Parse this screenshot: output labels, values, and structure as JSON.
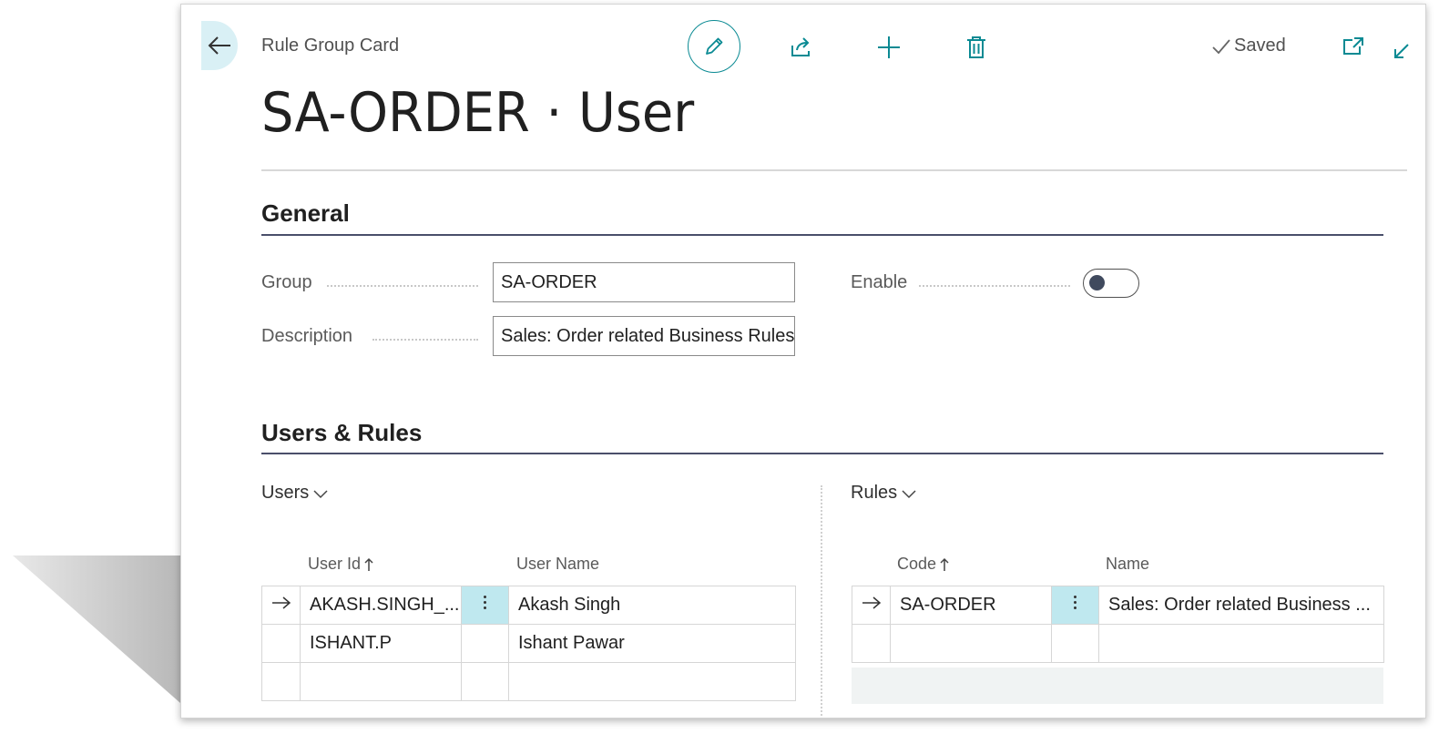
{
  "header": {
    "caption": "Rule Group Card",
    "saved_label": "Saved",
    "title": "SA-ORDER · User"
  },
  "icons": {
    "back": "back-arrow-icon",
    "edit": "pencil-icon",
    "share": "share-icon",
    "new": "plus-icon",
    "delete": "trash-icon",
    "open_new": "open-in-new-window-icon",
    "collapse": "collapse-icon",
    "check": "check-icon"
  },
  "colors": {
    "accent": "#0a8a93",
    "selected_cell": "#bfe8ef",
    "back_button": "#d9f0f5",
    "section_line": "#4a4f6a"
  },
  "general": {
    "heading": "General",
    "group_label": "Group",
    "group_value": "SA-ORDER",
    "description_label": "Description",
    "description_value": "Sales: Order related Business Rules",
    "enable_label": "Enable",
    "enable_value": false
  },
  "users_rules": {
    "heading": "Users & Rules",
    "users": {
      "title": "Users",
      "columns": [
        "User Id",
        "User Name"
      ],
      "rows": [
        {
          "user_id": "AKASH.SINGH_...",
          "user_name": "Akash Singh",
          "selected": true
        },
        {
          "user_id": "ISHANT.P",
          "user_name": "Ishant Pawar",
          "selected": false
        },
        {
          "user_id": "",
          "user_name": "",
          "selected": false
        }
      ]
    },
    "rules": {
      "title": "Rules",
      "columns": [
        "Code",
        "Name"
      ],
      "rows": [
        {
          "code": "SA-ORDER",
          "name": "Sales: Order related Business ...",
          "selected": true
        },
        {
          "code": "",
          "name": "",
          "selected": false
        }
      ]
    }
  }
}
